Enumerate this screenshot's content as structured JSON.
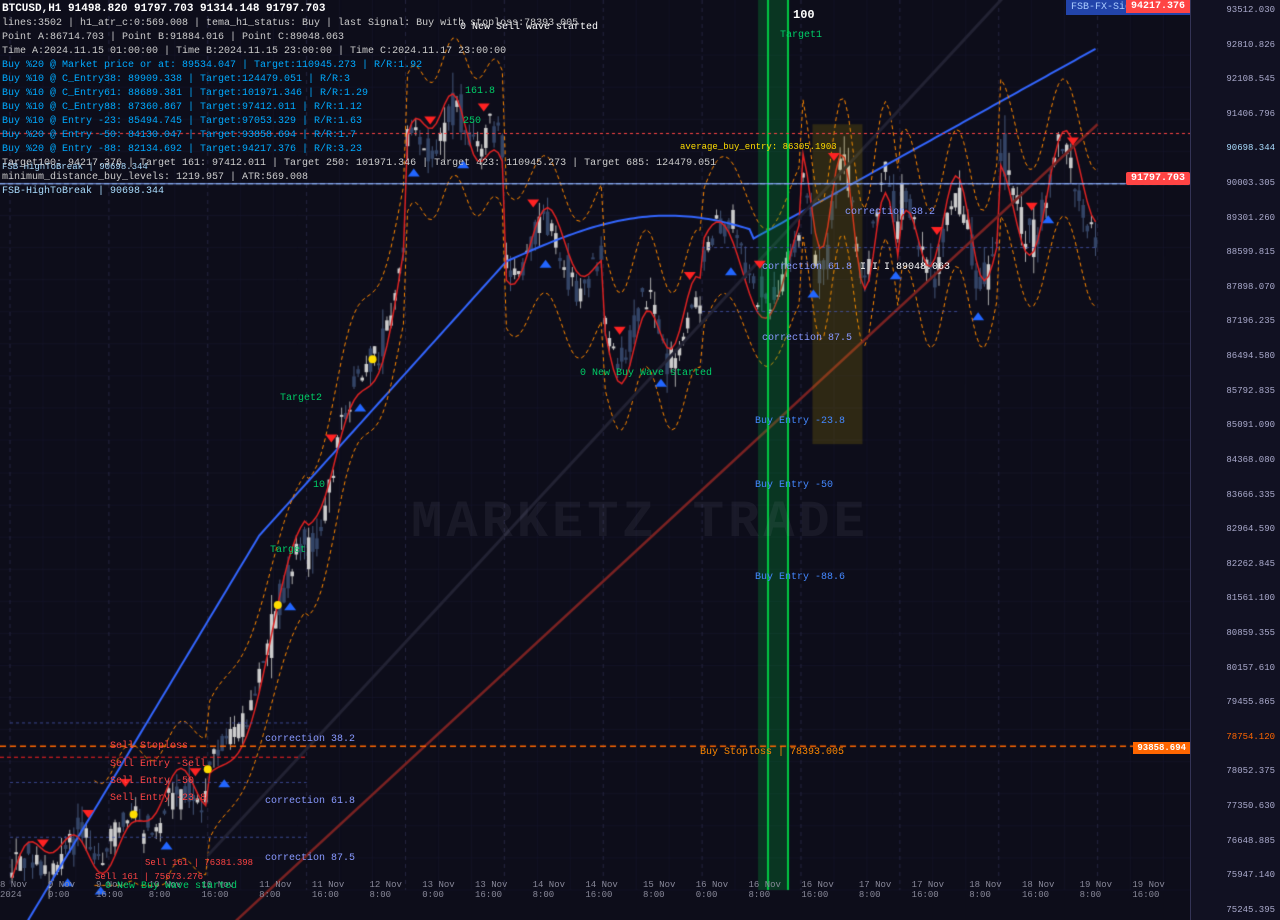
{
  "chart": {
    "title": "BTCUSD,H1  91498.820  91797.703  91314.148  91797.703",
    "subtitle": "lines:3502  |  h1_atr_c:0:569.008  |  tema_h1_status: Buy  |  last Signal: Buy with stoploss:78393.005",
    "points": "Point A:86714.703  |  Point B:91884.016  |  Point C:89048.063",
    "timeA": "Time A:2024.11.15 01:00:00  |  Time B:2024.11.15 23:00:00  |  Time C:2024.11.17 23:00:00",
    "buy_lines": [
      "Buy %20 @ Market price or at: 89534.047  |  Target:110945.273  |  R/R:1.92",
      "Buy %10 @ C_Entry38: 89909.338  |  Target:124479.051  |  R/R:3",
      "Buy %10 @ C_Entry61: 88689.381  |  Target:101971.346  |  R/R:1.29",
      "Buy %10 @ C_Entry88: 87360.867  |  Target:97412.011  |  R/R:1.12",
      "Buy %10 @ Entry -23: 85494.745  |  Target:97053.329  |  R/R:1.63",
      "Buy %20 @ Entry -50: 84130.047  |  Target:93858.694  |  R/R:1.7",
      "Buy %20 @ Entry -88: 82134.692  |  Target:94217.376  |  R/R:3.23"
    ],
    "targets": "Target100: 94217.376  |  Target 161: 97412.011  |  Target 250: 101971.346  |  Target 423: 110945.273  |  Target 685: 124479.051",
    "minimum_distance": "minimum_distance_buy_levels: 1219.957  |  ATR:569.008",
    "fsb_break": "FSB-HighToBreak | 90698.344",
    "watermark": "MARKETZ TRADE",
    "fsb_signal_reader": "FSB-FX-SignalReader",
    "current_price_badge": "94217.376",
    "price_display": "91797.703",
    "price_box": "93858.694"
  },
  "price_scale": {
    "prices": [
      "93512.030",
      "92810.826",
      "92108.545",
      "91406.796",
      "90698.344",
      "90003.305",
      "89301.260",
      "88599.815",
      "87898.070",
      "87196.235",
      "86494.580",
      "85792.835",
      "85091.090",
      "84368.080",
      "83666.335",
      "82964.590",
      "82262.845",
      "81561.100",
      "80859.355",
      "80157.610",
      "79455.865",
      "78754.120",
      "78052.375",
      "77350.630",
      "76648.885",
      "75947.140",
      "75245.395"
    ],
    "highlighted": "91797.703",
    "red_label": "93858.694",
    "orange_label": "78393.005"
  },
  "time_axis": {
    "labels": [
      "8 Nov 2024",
      "9 Nov 0:00",
      "9 Nov 16:00",
      "10 Nov 8:00",
      "10 Nov 16:00",
      "11 Nov 8:00",
      "11 Nov 16:00",
      "12 Nov 8:00",
      "13 Nov 0:00",
      "13 Nov 16:00",
      "14 Nov 8:00",
      "14 Nov 16:00",
      "15 Nov 8:00",
      "16 Nov 0:00",
      "16 Nov 8:00",
      "16 Nov 16:00",
      "17 Nov 8:00",
      "17 Nov 16:00",
      "18 Nov 8:00",
      "18 Nov 16:00",
      "19 Nov 8:00",
      "19 Nov 16:00"
    ]
  },
  "annotations": {
    "correction_875_top": "correction 87.5",
    "correction_618_top": "correction 61.8",
    "correction_382_top": "correction 38.2",
    "correction_875_bot": "correction 87.5",
    "correction_618_bot": "correction 61.8",
    "correction_382_bot": "correction 38.2",
    "target1": "Target1",
    "target2": "Target2",
    "target_label": "Target",
    "label_100": "100",
    "label_161": "161.8",
    "label_250": "250",
    "label_10": "10",
    "buy_entry_238": "Buy Entry -23.8",
    "buy_entry_50": "Buy Entry -50",
    "buy_entry_886": "Buy Entry -88.6",
    "buy_stoploss": "Buy Stoploss | 78393.005",
    "sell_stoploss": "Sell Stoploss",
    "sell_entry_sell": "Sell Entry -Sell",
    "sell_entry_50": "Sell Entry -50",
    "sell_entry_238": "Sell Entry -23.8",
    "new_buy_wave_top": "0 New Buy Wave started",
    "new_sell_wave": "0 New Sell wave started",
    "new_buy_wave_bot": "0 New Buy Wave started",
    "average_buy": "average_buy_entry: 86305.1903",
    "iii_label": "I I I 89048.063",
    "sell161": "Sell 161 | 75673.276",
    "sell100": "Sell 161 | 76381.398",
    "fsb_break_line": "FSB-HighToBreak | 90698.344"
  },
  "colors": {
    "bg": "#0d0d1a",
    "grid": "#1a1a33",
    "blue_line": "#4466ff",
    "red_line": "#ff3333",
    "green_zone": "#00aa44",
    "yellow_zone": "#ccaa00",
    "orange_zone": "#cc6600",
    "up_candle": "#dddddd",
    "down_candle": "#333344",
    "buy_stoploss": "#ff6600",
    "sell_stoploss": "#ff4444",
    "correction_line": "#6688ff"
  }
}
